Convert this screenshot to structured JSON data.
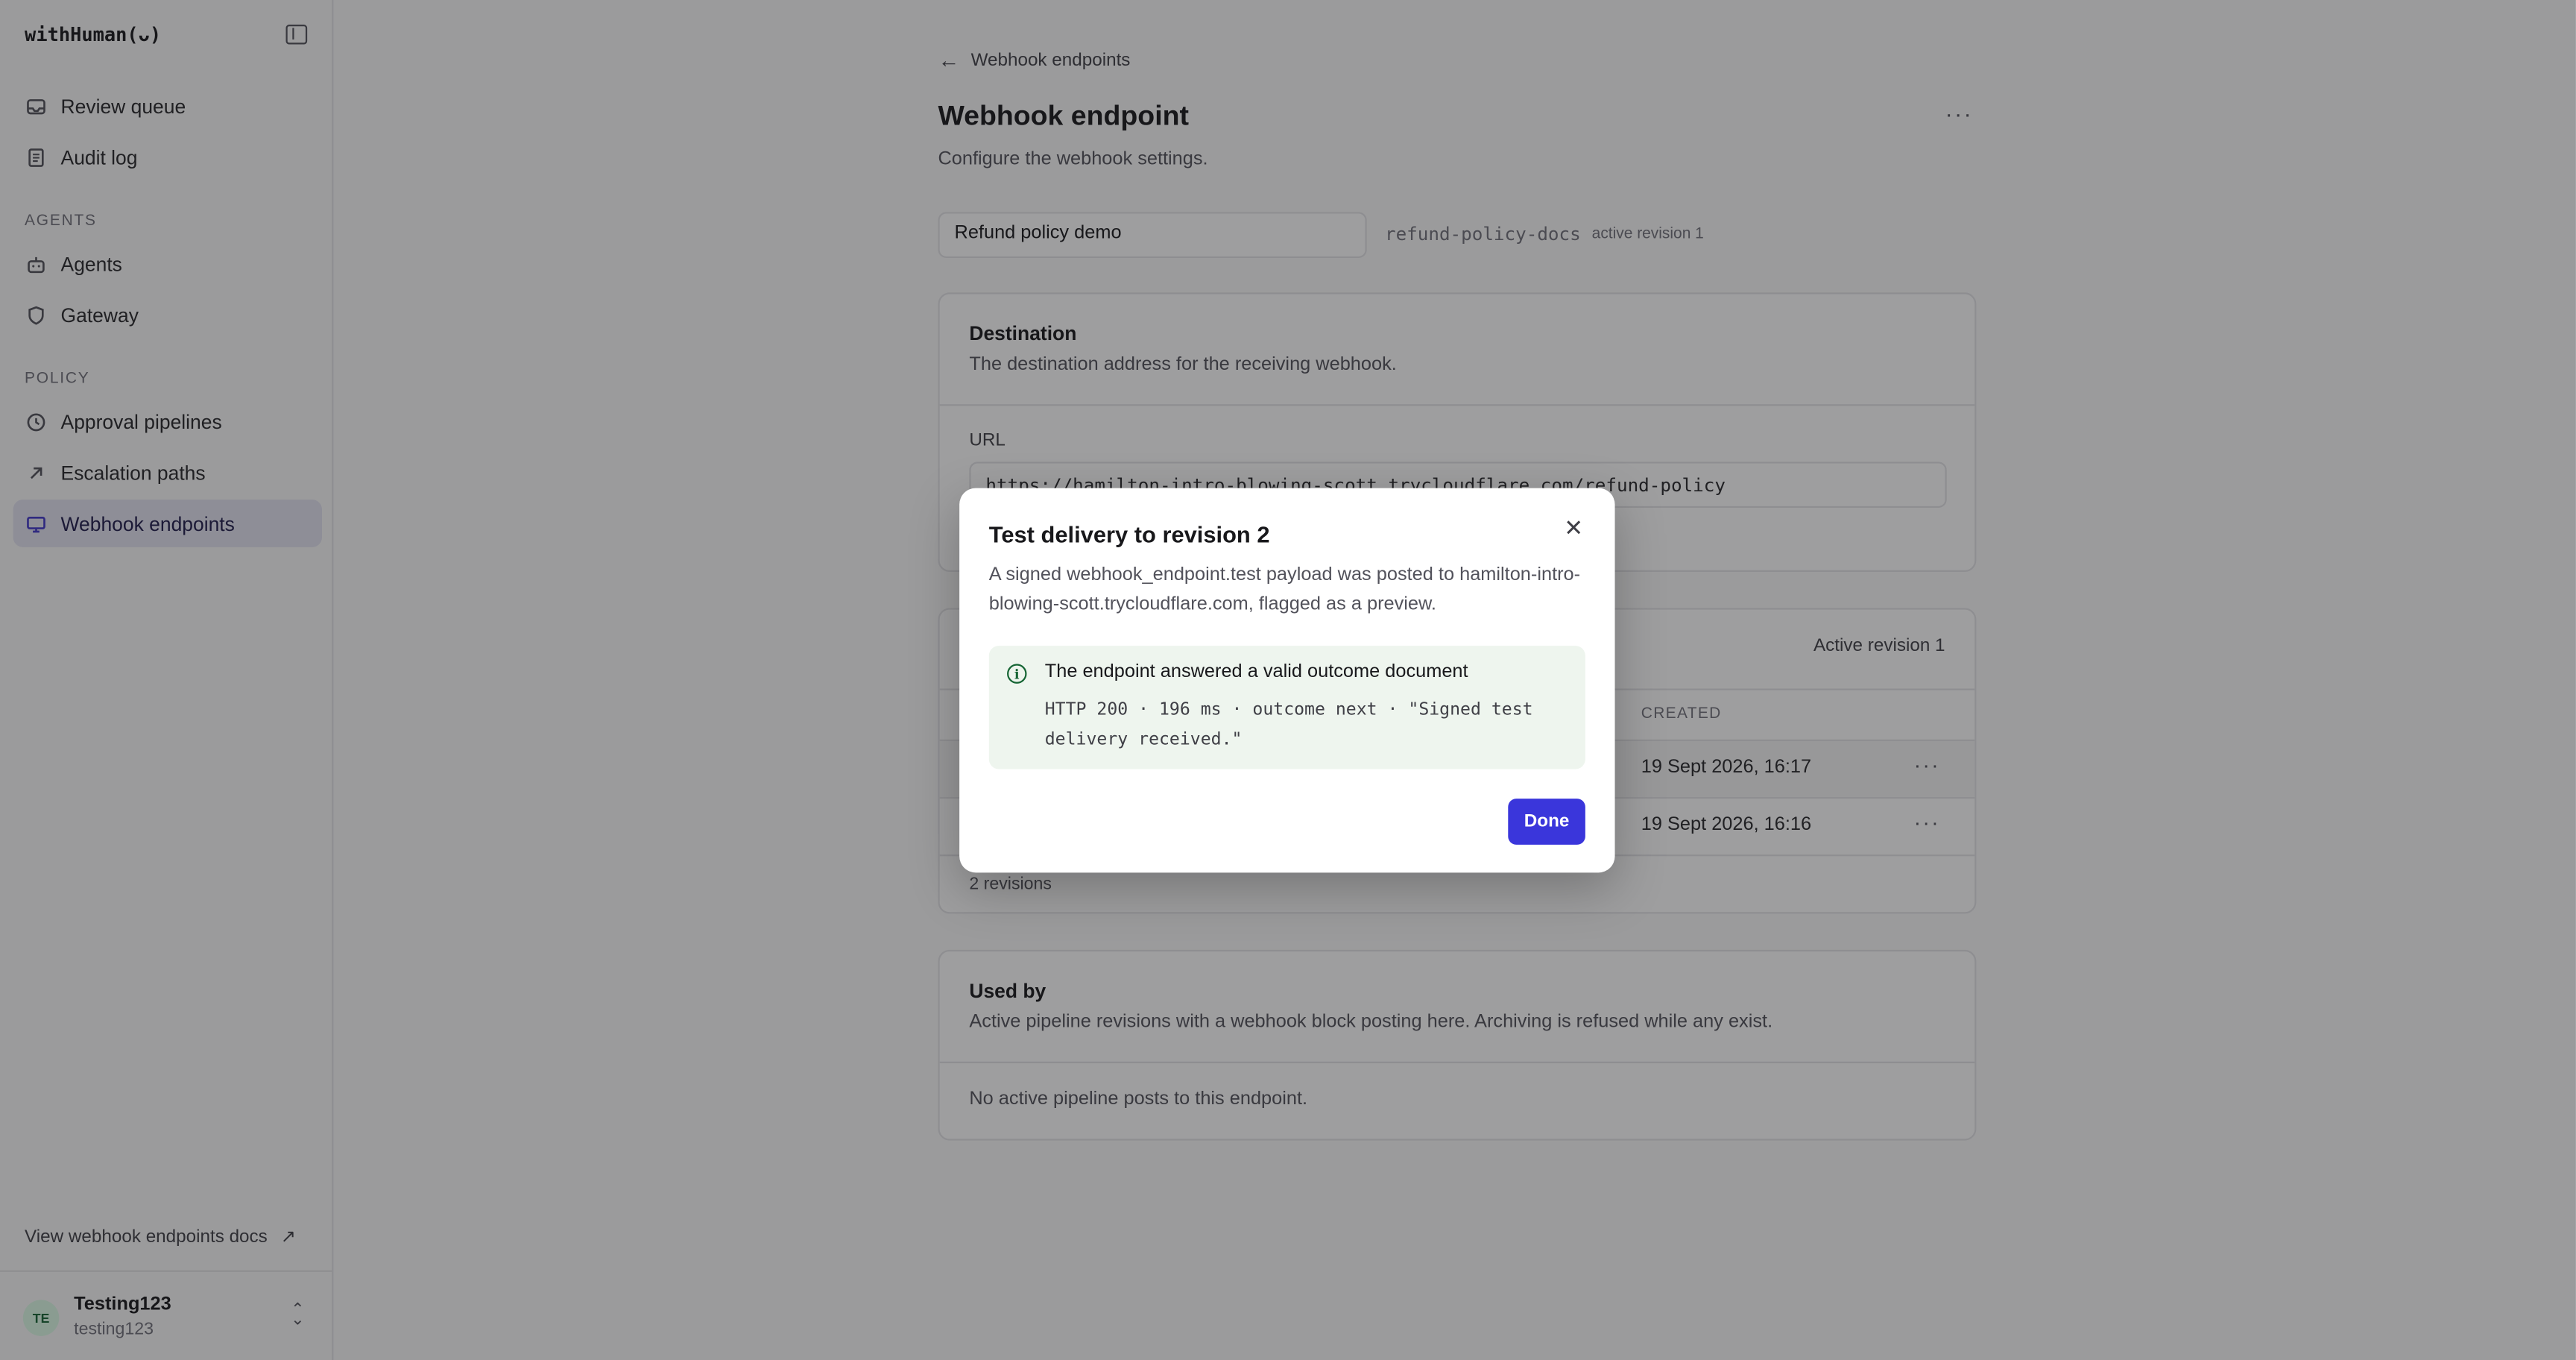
{
  "app": {
    "brand": "withHuman(ᴗ)"
  },
  "sidebar": {
    "items_top": [
      {
        "label": "Review queue",
        "icon": "inbox-icon"
      },
      {
        "label": "Audit log",
        "icon": "document-icon"
      }
    ],
    "section_agents": "AGENTS",
    "items_agents": [
      {
        "label": "Agents",
        "icon": "bot-icon"
      },
      {
        "label": "Gateway",
        "icon": "shield-icon"
      }
    ],
    "section_policy": "POLICY",
    "items_policy": [
      {
        "label": "Approval pipelines",
        "icon": "clock-icon"
      },
      {
        "label": "Escalation paths",
        "icon": "arrow-up-right-icon"
      },
      {
        "label": "Webhook endpoints",
        "icon": "monitor-icon",
        "active": true
      }
    ],
    "docs_link": "View webhook endpoints docs",
    "user": {
      "initials": "TE",
      "name": "Testing123",
      "handle": "testing123"
    }
  },
  "main": {
    "back_link": "Webhook endpoints",
    "title": "Webhook endpoint",
    "subtitle": "Configure the webhook settings.",
    "name_value": "Refund policy demo",
    "slug": "refund-policy-docs",
    "revision_tag": "active revision 1",
    "destination": {
      "title": "Destination",
      "description": "The destination address for the receiving webhook.",
      "url_label": "URL",
      "url_value": "https://hamilton-intro-blowing-scott.trycloudflare.com/refund-policy"
    },
    "revisions": {
      "active_label": "Active revision 1",
      "created_header": "CREATED",
      "rows": [
        {
          "created": "19 Sept 2026, 16:17"
        },
        {
          "created": "19 Sept 2026, 16:16"
        }
      ],
      "count": "2 revisions"
    },
    "used_by": {
      "title": "Used by",
      "description": "Active pipeline revisions with a webhook block posting here. Archiving is refused while any exist.",
      "empty": "No active pipeline posts to this endpoint."
    }
  },
  "modal": {
    "title": "Test delivery to revision 2",
    "description": "A signed webhook_endpoint.test payload was posted to hamilton-intro-blowing-scott.trycloudflare.com, flagged as a preview.",
    "alert_title": "The endpoint answered a valid outcome document",
    "alert_body": "HTTP 200 · 196 ms · outcome next · \"Signed test delivery received.\"",
    "done_label": "Done"
  },
  "colors": {
    "accent": "#3a36db",
    "success": "#166534"
  }
}
